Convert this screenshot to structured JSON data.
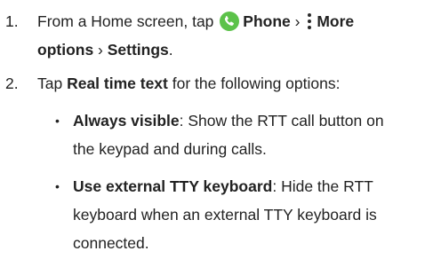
{
  "steps": [
    {
      "number": "1.",
      "line1_pre": "From a Home screen, tap ",
      "phone_label": "Phone",
      "sep1": " › ",
      "more_label": "More",
      "line2_more": "options",
      "sep2": " › ",
      "settings_label": "Settings",
      "end": "."
    },
    {
      "number": "2.",
      "pre": "Tap ",
      "rtt_label": "Real time text",
      "post": " for the following options:"
    }
  ],
  "options": [
    {
      "name": "Always visible",
      "line1": ": Show the RTT call button on",
      "line2": "the keypad and during calls."
    },
    {
      "name": "Use external TTY keyboard",
      "line1": ": Hide the RTT",
      "line2": "keyboard when an external TTY keyboard is",
      "line3": "connected."
    }
  ],
  "icons": {
    "phone": "phone-icon",
    "more": "more-options-icon",
    "phone_color": "#5cc24a"
  }
}
